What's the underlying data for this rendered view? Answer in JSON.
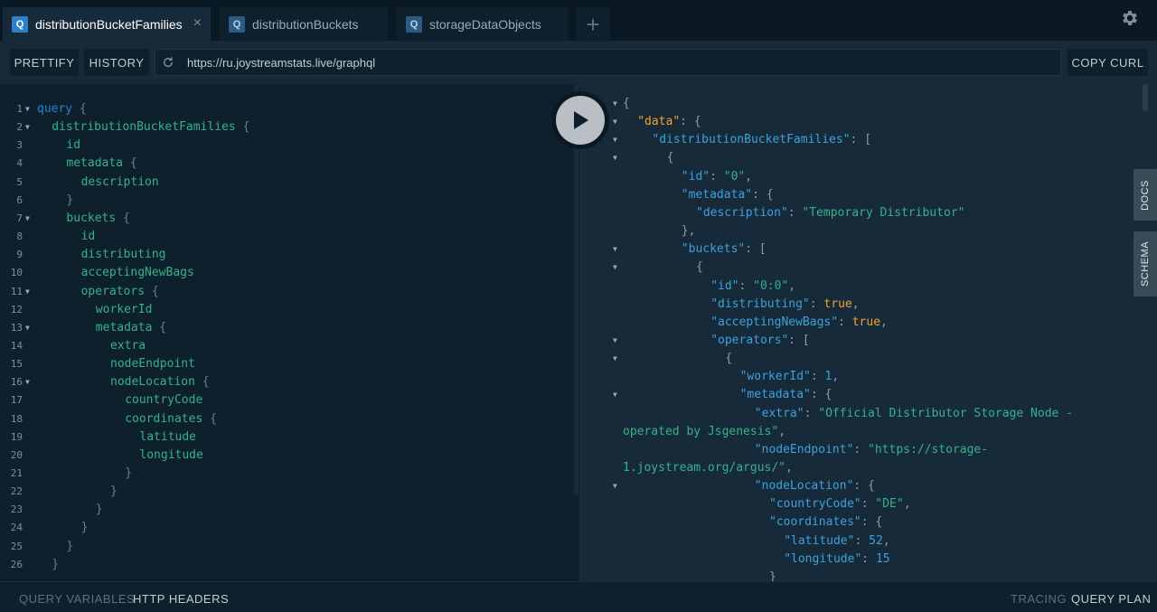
{
  "tabs": [
    {
      "badge": "Q",
      "label": "distributionBucketFamilies",
      "close": "×"
    },
    {
      "badge": "Q",
      "label": "distributionBuckets"
    },
    {
      "badge": "Q",
      "label": "storageDataObjects"
    }
  ],
  "add_tab_label": "+",
  "toolbar": {
    "prettify_label": "PRETTIFY",
    "history_label": "HISTORY",
    "url": "https://ru.joystreamstats.live/graphql",
    "copy_curl_label": "COPY CURL"
  },
  "editor_lines": [
    {
      "n": "1",
      "fold": "▼",
      "ind": 0,
      "parts": [
        [
          "kw",
          "query"
        ],
        [
          "br",
          " {"
        ]
      ]
    },
    {
      "n": "2",
      "fold": "▼",
      "ind": 1,
      "parts": [
        [
          "fld",
          "distributionBucketFamilies"
        ],
        [
          "br",
          " {"
        ]
      ]
    },
    {
      "n": "3",
      "fold": "",
      "ind": 2,
      "parts": [
        [
          "fld",
          "id"
        ]
      ]
    },
    {
      "n": "4",
      "fold": "",
      "ind": 2,
      "parts": [
        [
          "fld",
          "metadata"
        ],
        [
          "br",
          " {"
        ]
      ]
    },
    {
      "n": "5",
      "fold": "",
      "ind": 3,
      "parts": [
        [
          "fld",
          "description"
        ]
      ]
    },
    {
      "n": "6",
      "fold": "",
      "ind": 2,
      "parts": [
        [
          "br",
          "}"
        ]
      ]
    },
    {
      "n": "7",
      "fold": "▼",
      "ind": 2,
      "parts": [
        [
          "fld",
          "buckets"
        ],
        [
          "br",
          " {"
        ]
      ]
    },
    {
      "n": "8",
      "fold": "",
      "ind": 3,
      "parts": [
        [
          "fld",
          "id"
        ]
      ]
    },
    {
      "n": "9",
      "fold": "",
      "ind": 3,
      "parts": [
        [
          "fld",
          "distributing"
        ]
      ]
    },
    {
      "n": "10",
      "fold": "",
      "ind": 3,
      "parts": [
        [
          "fld",
          "acceptingNewBags"
        ]
      ]
    },
    {
      "n": "11",
      "fold": "▼",
      "ind": 3,
      "parts": [
        [
          "fld",
          "operators"
        ],
        [
          "br",
          " {"
        ]
      ]
    },
    {
      "n": "12",
      "fold": "",
      "ind": 4,
      "parts": [
        [
          "fld",
          "workerId"
        ]
      ]
    },
    {
      "n": "13",
      "fold": "▼",
      "ind": 4,
      "parts": [
        [
          "fld",
          "metadata"
        ],
        [
          "br",
          " {"
        ]
      ]
    },
    {
      "n": "14",
      "fold": "",
      "ind": 5,
      "parts": [
        [
          "fld",
          "extra"
        ]
      ]
    },
    {
      "n": "15",
      "fold": "",
      "ind": 5,
      "parts": [
        [
          "fld",
          "nodeEndpoint"
        ]
      ]
    },
    {
      "n": "16",
      "fold": "▼",
      "ind": 5,
      "parts": [
        [
          "fld",
          "nodeLocation"
        ],
        [
          "br",
          " {"
        ]
      ]
    },
    {
      "n": "17",
      "fold": "",
      "ind": 6,
      "parts": [
        [
          "fld",
          "countryCode"
        ]
      ]
    },
    {
      "n": "18",
      "fold": "",
      "ind": 6,
      "parts": [
        [
          "fld",
          "coordinates"
        ],
        [
          "br",
          " {"
        ]
      ]
    },
    {
      "n": "19",
      "fold": "",
      "ind": 7,
      "parts": [
        [
          "fld",
          "latitude"
        ]
      ]
    },
    {
      "n": "20",
      "fold": "",
      "ind": 7,
      "parts": [
        [
          "fld",
          "longitude"
        ]
      ]
    },
    {
      "n": "21",
      "fold": "",
      "ind": 6,
      "parts": [
        [
          "br",
          "}"
        ]
      ]
    },
    {
      "n": "22",
      "fold": "",
      "ind": 5,
      "parts": [
        [
          "br",
          "}"
        ]
      ]
    },
    {
      "n": "23",
      "fold": "",
      "ind": 4,
      "parts": [
        [
          "br",
          "}"
        ]
      ]
    },
    {
      "n": "24",
      "fold": "",
      "ind": 3,
      "parts": [
        [
          "br",
          "}"
        ]
      ]
    },
    {
      "n": "25",
      "fold": "",
      "ind": 2,
      "parts": [
        [
          "br",
          "}"
        ]
      ]
    },
    {
      "n": "26",
      "fold": "",
      "ind": 1,
      "parts": [
        [
          "br",
          "}"
        ]
      ]
    }
  ],
  "result_lines": [
    {
      "fold": "▼",
      "ind": 0,
      "parts": [
        [
          "pun",
          "{"
        ]
      ]
    },
    {
      "fold": "▼",
      "ind": 1,
      "parts": [
        [
          "key-data",
          "\"data\""
        ],
        [
          "pun",
          ": {"
        ]
      ]
    },
    {
      "fold": "▼",
      "ind": 2,
      "parts": [
        [
          "key",
          "\"distributionBucketFamilies\""
        ],
        [
          "pun",
          ": ["
        ]
      ]
    },
    {
      "fold": "▼",
      "ind": 3,
      "parts": [
        [
          "pun",
          "{"
        ]
      ]
    },
    {
      "fold": "",
      "ind": 4,
      "parts": [
        [
          "key",
          "\"id\""
        ],
        [
          "pun",
          ": "
        ],
        [
          "str",
          "\"0\""
        ],
        [
          "pun",
          ","
        ]
      ]
    },
    {
      "fold": "",
      "ind": 4,
      "parts": [
        [
          "key",
          "\"metadata\""
        ],
        [
          "pun",
          ": {"
        ]
      ]
    },
    {
      "fold": "",
      "ind": 5,
      "parts": [
        [
          "key",
          "\"description\""
        ],
        [
          "pun",
          ": "
        ],
        [
          "str",
          "\"Temporary Distributor\""
        ]
      ]
    },
    {
      "fold": "",
      "ind": 4,
      "parts": [
        [
          "pun",
          "},"
        ]
      ]
    },
    {
      "fold": "▼",
      "ind": 4,
      "parts": [
        [
          "key",
          "\"buckets\""
        ],
        [
          "pun",
          ": ["
        ]
      ]
    },
    {
      "fold": "▼",
      "ind": 5,
      "parts": [
        [
          "pun",
          "{"
        ]
      ]
    },
    {
      "fold": "",
      "ind": 6,
      "parts": [
        [
          "key",
          "\"id\""
        ],
        [
          "pun",
          ": "
        ],
        [
          "str",
          "\"0:0\""
        ],
        [
          "pun",
          ","
        ]
      ]
    },
    {
      "fold": "",
      "ind": 6,
      "parts": [
        [
          "key",
          "\"distributing\""
        ],
        [
          "pun",
          ": "
        ],
        [
          "bool",
          "true"
        ],
        [
          "pun",
          ","
        ]
      ]
    },
    {
      "fold": "",
      "ind": 6,
      "parts": [
        [
          "key",
          "\"acceptingNewBags\""
        ],
        [
          "pun",
          ": "
        ],
        [
          "bool",
          "true"
        ],
        [
          "pun",
          ","
        ]
      ]
    },
    {
      "fold": "▼",
      "ind": 6,
      "parts": [
        [
          "key",
          "\"operators\""
        ],
        [
          "pun",
          ": ["
        ]
      ]
    },
    {
      "fold": "▼",
      "ind": 7,
      "parts": [
        [
          "pun",
          "{"
        ]
      ]
    },
    {
      "fold": "",
      "ind": 8,
      "parts": [
        [
          "key",
          "\"workerId\""
        ],
        [
          "pun",
          ": "
        ],
        [
          "num",
          "1"
        ],
        [
          "pun",
          ","
        ]
      ]
    },
    {
      "fold": "▼",
      "ind": 8,
      "parts": [
        [
          "key",
          "\"metadata\""
        ],
        [
          "pun",
          ": {"
        ]
      ]
    },
    {
      "fold": "",
      "ind": 9,
      "parts": [
        [
          "key",
          "\"extra\""
        ],
        [
          "pun",
          ": "
        ],
        [
          "str",
          "\"Official Distributor Storage Node -"
        ]
      ]
    },
    {
      "fold": "",
      "ind": -1,
      "parts": [
        [
          "str",
          "operated by Jsgenesis\""
        ],
        [
          "pun",
          ","
        ]
      ]
    },
    {
      "fold": "",
      "ind": 9,
      "parts": [
        [
          "key",
          "\"nodeEndpoint\""
        ],
        [
          "pun",
          ": "
        ],
        [
          "str",
          "\"https://storage-"
        ]
      ]
    },
    {
      "fold": "",
      "ind": -1,
      "parts": [
        [
          "str",
          "1.joystream.org/argus/\""
        ],
        [
          "pun",
          ","
        ]
      ]
    },
    {
      "fold": "▼",
      "ind": 9,
      "parts": [
        [
          "key",
          "\"nodeLocation\""
        ],
        [
          "pun",
          ": {"
        ]
      ]
    },
    {
      "fold": "",
      "ind": 10,
      "parts": [
        [
          "key",
          "\"countryCode\""
        ],
        [
          "pun",
          ": "
        ],
        [
          "str",
          "\"DE\""
        ],
        [
          "pun",
          ","
        ]
      ]
    },
    {
      "fold": "",
      "ind": 10,
      "parts": [
        [
          "key",
          "\"coordinates\""
        ],
        [
          "pun",
          ": {"
        ]
      ]
    },
    {
      "fold": "",
      "ind": 11,
      "parts": [
        [
          "key",
          "\"latitude\""
        ],
        [
          "pun",
          ": "
        ],
        [
          "num",
          "52"
        ],
        [
          "pun",
          ","
        ]
      ]
    },
    {
      "fold": "",
      "ind": 11,
      "parts": [
        [
          "key",
          "\"longitude\""
        ],
        [
          "pun",
          ": "
        ],
        [
          "num",
          "15"
        ]
      ]
    },
    {
      "fold": "",
      "ind": 10,
      "parts": [
        [
          "pun",
          "}"
        ]
      ]
    }
  ],
  "side_tabs": {
    "docs": "DOCS",
    "schema": "SCHEMA"
  },
  "footer": {
    "query_variables": "QUERY VARIABLES",
    "http_headers": "HTTP HEADERS",
    "tracing": "TRACING",
    "query_plan": "QUERY PLAN"
  },
  "colors": {
    "background": "#0f202d",
    "panel": "#172a3a",
    "keyword": "#2a7ed2",
    "field": "#36b18a",
    "json_key": "#3ea1dc",
    "data_key": "#f3a234"
  }
}
